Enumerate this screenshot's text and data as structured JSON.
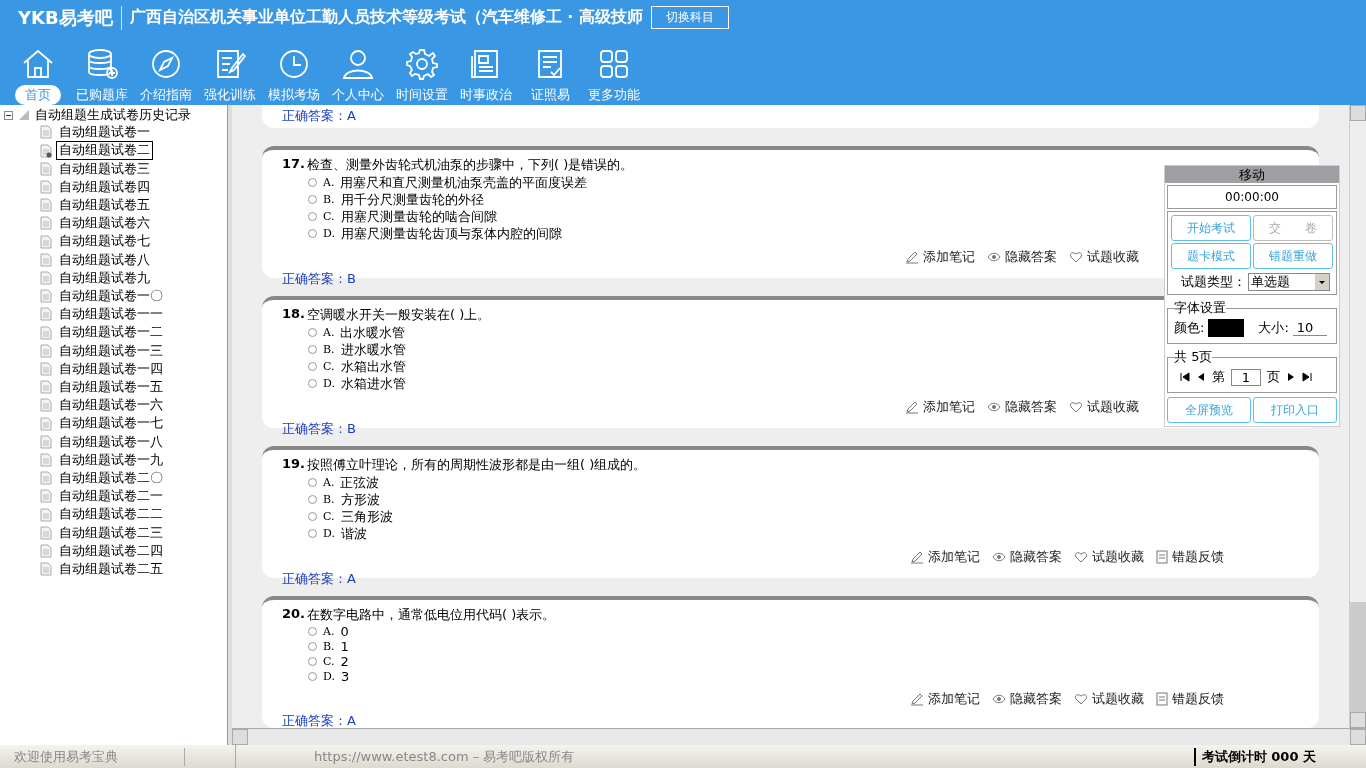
{
  "header": {
    "logo": "YKB易考吧",
    "title": "广西自治区机关事业单位工勤人员技术等级考试（汽车维修工 · 高级技师",
    "switch_button": "切换科目"
  },
  "nav": [
    {
      "label": "首页",
      "selected": true
    },
    {
      "label": "已购题库",
      "selected": false
    },
    {
      "label": "介绍指南",
      "selected": false
    },
    {
      "label": "强化训练",
      "selected": false
    },
    {
      "label": "模拟考场",
      "selected": false
    },
    {
      "label": "个人中心",
      "selected": false
    },
    {
      "label": "时间设置",
      "selected": false
    },
    {
      "label": "时事政治",
      "selected": false
    },
    {
      "label": "证照易",
      "selected": false
    },
    {
      "label": "更多功能",
      "selected": false
    }
  ],
  "tree": {
    "label": "自动组题生成试卷历史记录",
    "expanded": true,
    "children": [
      {
        "label": "自动组题试卷一",
        "selected": false
      },
      {
        "label": "自动组题试卷二",
        "selected": true
      },
      {
        "label": "自动组题试卷三",
        "selected": false
      },
      {
        "label": "自动组题试卷四",
        "selected": false
      },
      {
        "label": "自动组题试卷五",
        "selected": false
      },
      {
        "label": "自动组题试卷六",
        "selected": false
      },
      {
        "label": "自动组题试卷七",
        "selected": false
      },
      {
        "label": "自动组题试卷八",
        "selected": false
      },
      {
        "label": "自动组题试卷九",
        "selected": false
      },
      {
        "label": "自动组题试卷一〇",
        "selected": false
      },
      {
        "label": "自动组题试卷一一",
        "selected": false
      },
      {
        "label": "自动组题试卷一二",
        "selected": false
      },
      {
        "label": "自动组题试卷一三",
        "selected": false
      },
      {
        "label": "自动组题试卷一四",
        "selected": false
      },
      {
        "label": "自动组题试卷一五",
        "selected": false
      },
      {
        "label": "自动组题试卷一六",
        "selected": false
      },
      {
        "label": "自动组题试卷一七",
        "selected": false
      },
      {
        "label": "自动组题试卷一八",
        "selected": false
      },
      {
        "label": "自动组题试卷一九",
        "selected": false
      },
      {
        "label": "自动组题试卷二〇",
        "selected": false
      },
      {
        "label": "自动组题试卷二一",
        "selected": false
      },
      {
        "label": "自动组题试卷二二",
        "selected": false
      },
      {
        "label": "自动组题试卷二三",
        "selected": false
      },
      {
        "label": "自动组题试卷二四",
        "selected": false
      },
      {
        "label": "自动组题试卷二五",
        "selected": false
      }
    ]
  },
  "partial_answer": "正确答案：A",
  "questions": [
    {
      "number": "17.",
      "text": "检查、测量外齿轮式机油泵的步骤中，下列( )是错误的。",
      "options": [
        {
          "label": "A.",
          "text": "用塞尺和直尺测量机油泵壳盖的平面度误差",
          "selected": false
        },
        {
          "label": "B.",
          "text": "用千分尺测量齿轮的外径",
          "selected": false
        },
        {
          "label": "C.",
          "text": "用塞尺测量齿轮的啮合间隙",
          "selected": false
        },
        {
          "label": "D.",
          "text": "用塞尺测量齿轮齿顶与泵体内腔的间隙",
          "selected": false
        }
      ],
      "actions": [
        "添加笔记",
        "隐藏答案",
        "试题收藏"
      ],
      "answer": "正确答案：B"
    },
    {
      "number": "18.",
      "text": "空调暖水开关一般安装在( )上。",
      "options": [
        {
          "label": "A.",
          "text": "出水暖水管",
          "selected": false
        },
        {
          "label": "B.",
          "text": "进水暖水管",
          "selected": false
        },
        {
          "label": "C.",
          "text": "水箱出水管",
          "selected": false
        },
        {
          "label": "D.",
          "text": "水箱进水管",
          "selected": false
        }
      ],
      "actions": [
        "添加笔记",
        "隐藏答案",
        "试题收藏"
      ],
      "answer": "正确答案：B"
    },
    {
      "number": "19.",
      "text": "按照傅立叶理论，所有的周期性波形都是由一组( )组成的。",
      "options": [
        {
          "label": "A.",
          "text": "正弦波",
          "selected": false
        },
        {
          "label": "B.",
          "text": "方形波",
          "selected": false
        },
        {
          "label": "C.",
          "text": "三角形波",
          "selected": false
        },
        {
          "label": "D.",
          "text": "谐波",
          "selected": false
        }
      ],
      "actions": [
        "添加笔记",
        "隐藏答案",
        "试题收藏",
        "错题反馈"
      ],
      "answer": "正确答案：A"
    },
    {
      "number": "20.",
      "text": "在数字电路中，通常低电位用代码( )表示。",
      "options": [
        {
          "label": "A.",
          "text": "0",
          "selected": false
        },
        {
          "label": "B.",
          "text": "1",
          "selected": false
        },
        {
          "label": "C.",
          "text": "2",
          "selected": false
        },
        {
          "label": "D.",
          "text": "3",
          "selected": false
        }
      ],
      "actions": [
        "添加笔记",
        "隐藏答案",
        "试题收藏",
        "错题反馈"
      ],
      "answer": "正确答案：A"
    }
  ],
  "panel": {
    "title": "移动",
    "timer": "00:00:00",
    "buttons": [
      "开始考试",
      "交　　卷",
      "题卡模式",
      "错题重做"
    ],
    "type_label": "试题类型：",
    "type_value": "单选题",
    "font_legend": "字体设置",
    "color_label": "颜色:",
    "color": "#000000",
    "size_label": "大小:",
    "size_value": "10",
    "pages_legend": "共 5页",
    "page_prefix": "第",
    "page_value": "1",
    "page_suffix": "页",
    "bottom_buttons": [
      "全屏预览",
      "打印入口"
    ]
  },
  "status_bar": {
    "welcome": "欢迎使用易考宝典",
    "copyright": "https://www.etest8.com – 易考吧版权所有",
    "countdown": "考试倒计时 000 天"
  }
}
